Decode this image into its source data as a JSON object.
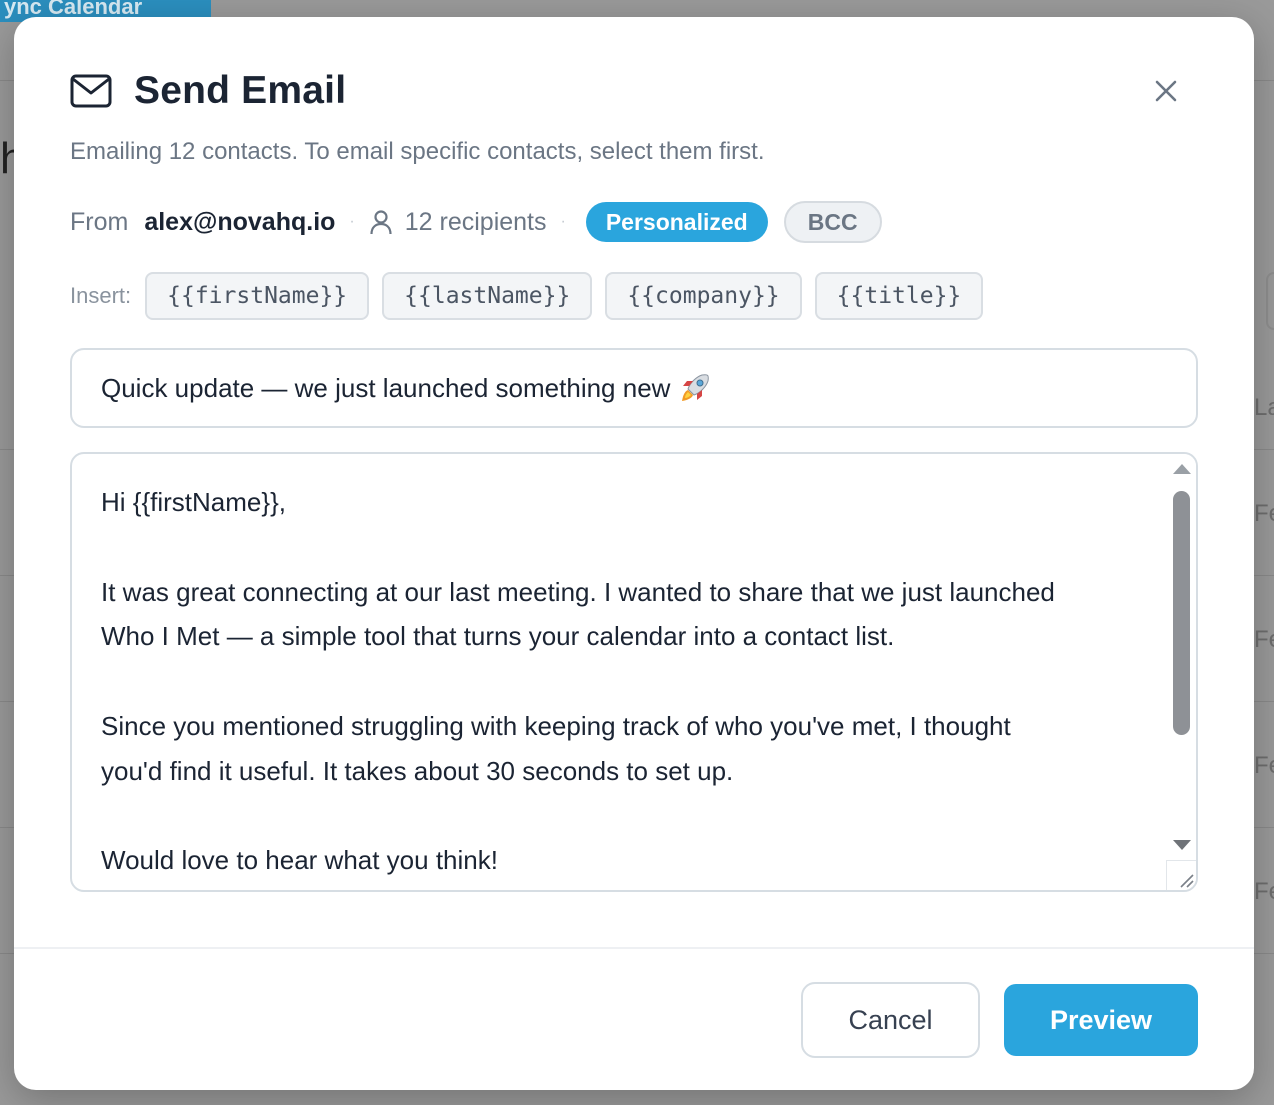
{
  "background": {
    "tab_label": "ync Calendar",
    "right_column_labels": [
      "La",
      "Fe",
      "Fe",
      "Fe",
      "Fe"
    ]
  },
  "modal": {
    "title": "Send Email",
    "subtitle": "Emailing 12 contacts. To email specific contacts, select them first.",
    "from_label": "From",
    "from_email": "alex@novahq.io",
    "recipients_label": "12 recipients",
    "badges": {
      "personalized": "Personalized",
      "bcc": "BCC"
    },
    "insert_label": "Insert:",
    "tokens": [
      "{{firstName}}",
      "{{lastName}}",
      "{{company}}",
      "{{title}}"
    ],
    "subject": "Quick update — we just launched something new",
    "body_lines": [
      "Hi {{firstName}},",
      "",
      "It was great connecting at our last meeting. I wanted to share that we just launched",
      "Who I Met — a simple tool that turns your calendar into a contact list.",
      "",
      "Since you mentioned struggling with keeping track of who you've met, I thought",
      "you'd find it useful. It takes about 30 seconds to set up.",
      "",
      "Would love to hear what you think!"
    ],
    "buttons": {
      "cancel": "Cancel",
      "preview": "Preview"
    }
  },
  "colors": {
    "accent": "#2aa5dd",
    "heading": "#1b2433",
    "muted": "#6b7684",
    "overlay": "#9a9a9a"
  },
  "icons": {
    "header": "mail-icon",
    "close": "close-icon",
    "recipients": "user-icon",
    "subject_emoji": "rocket-icon"
  }
}
